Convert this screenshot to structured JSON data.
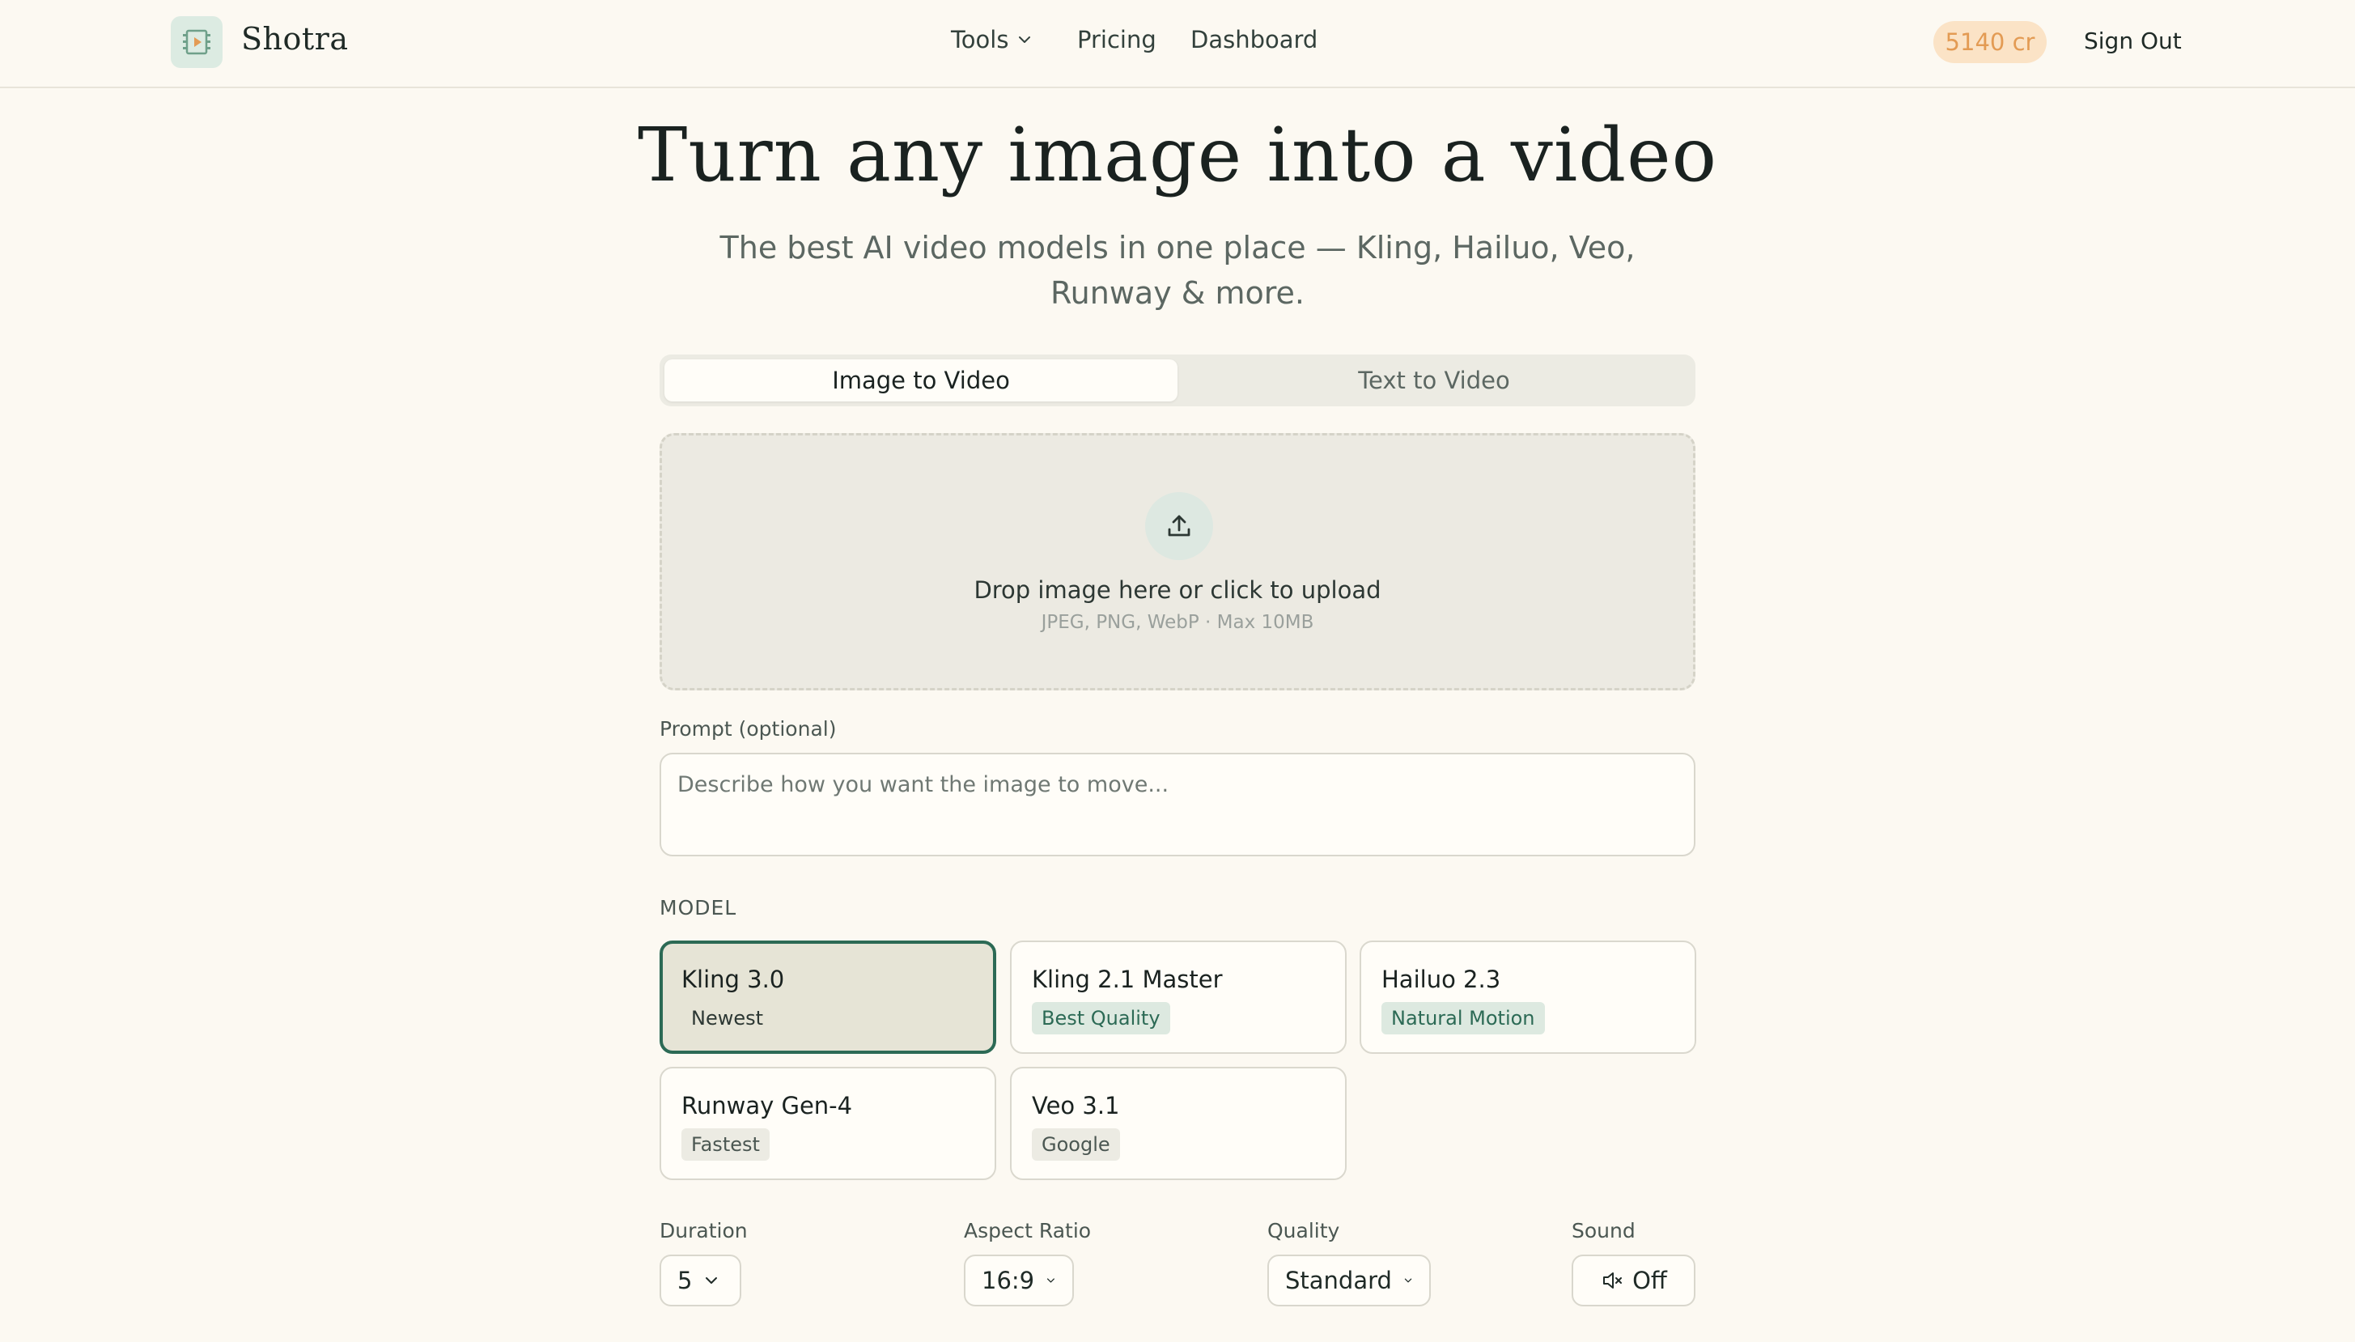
{
  "header": {
    "brand": "Shotra",
    "nav": {
      "tools": "Tools",
      "pricing": "Pricing",
      "dashboard": "Dashboard"
    },
    "credits": "5140 cr",
    "sign_out": "Sign Out"
  },
  "hero": {
    "title": "Turn any image into a video",
    "subtitle": "The best AI video models in one place — Kling, Hailuo, Veo, Runway & more."
  },
  "tabs": [
    {
      "label": "Image to Video",
      "active": true
    },
    {
      "label": "Text to Video",
      "active": false
    }
  ],
  "upload": {
    "main": "Drop image here or click to upload",
    "hint": "JPEG, PNG, WebP · Max 10MB"
  },
  "prompt": {
    "label": "Prompt (optional)",
    "placeholder": "Describe how you want the image to move...",
    "value": ""
  },
  "model": {
    "label": "MODEL",
    "options": [
      {
        "name": "Kling 3.0",
        "badge": "Newest",
        "selected": true
      },
      {
        "name": "Kling 2.1 Master",
        "badge": "Best Quality",
        "selected": false
      },
      {
        "name": "Hailuo 2.3",
        "badge": "Natural Motion",
        "selected": false
      },
      {
        "name": "Runway Gen-4",
        "badge": "Fastest",
        "selected": false
      },
      {
        "name": "Veo 3.1",
        "badge": "Google",
        "selected": false
      }
    ]
  },
  "settings": {
    "duration": {
      "label": "Duration",
      "value": "5"
    },
    "aspect_ratio": {
      "label": "Aspect Ratio",
      "value": "16:9"
    },
    "quality": {
      "label": "Quality",
      "value": "Standard"
    },
    "sound": {
      "label": "Sound",
      "value": "Off"
    }
  },
  "colors": {
    "background": "#fcf9f2",
    "accent": "#2c6a55",
    "credits_bg": "#fbe3c6",
    "credits_text": "#e39b54"
  },
  "icons": {
    "logo": "film-icon",
    "tools_dropdown": "chevron-down-icon",
    "upload": "upload-icon",
    "sound": "speaker-muted-icon"
  }
}
